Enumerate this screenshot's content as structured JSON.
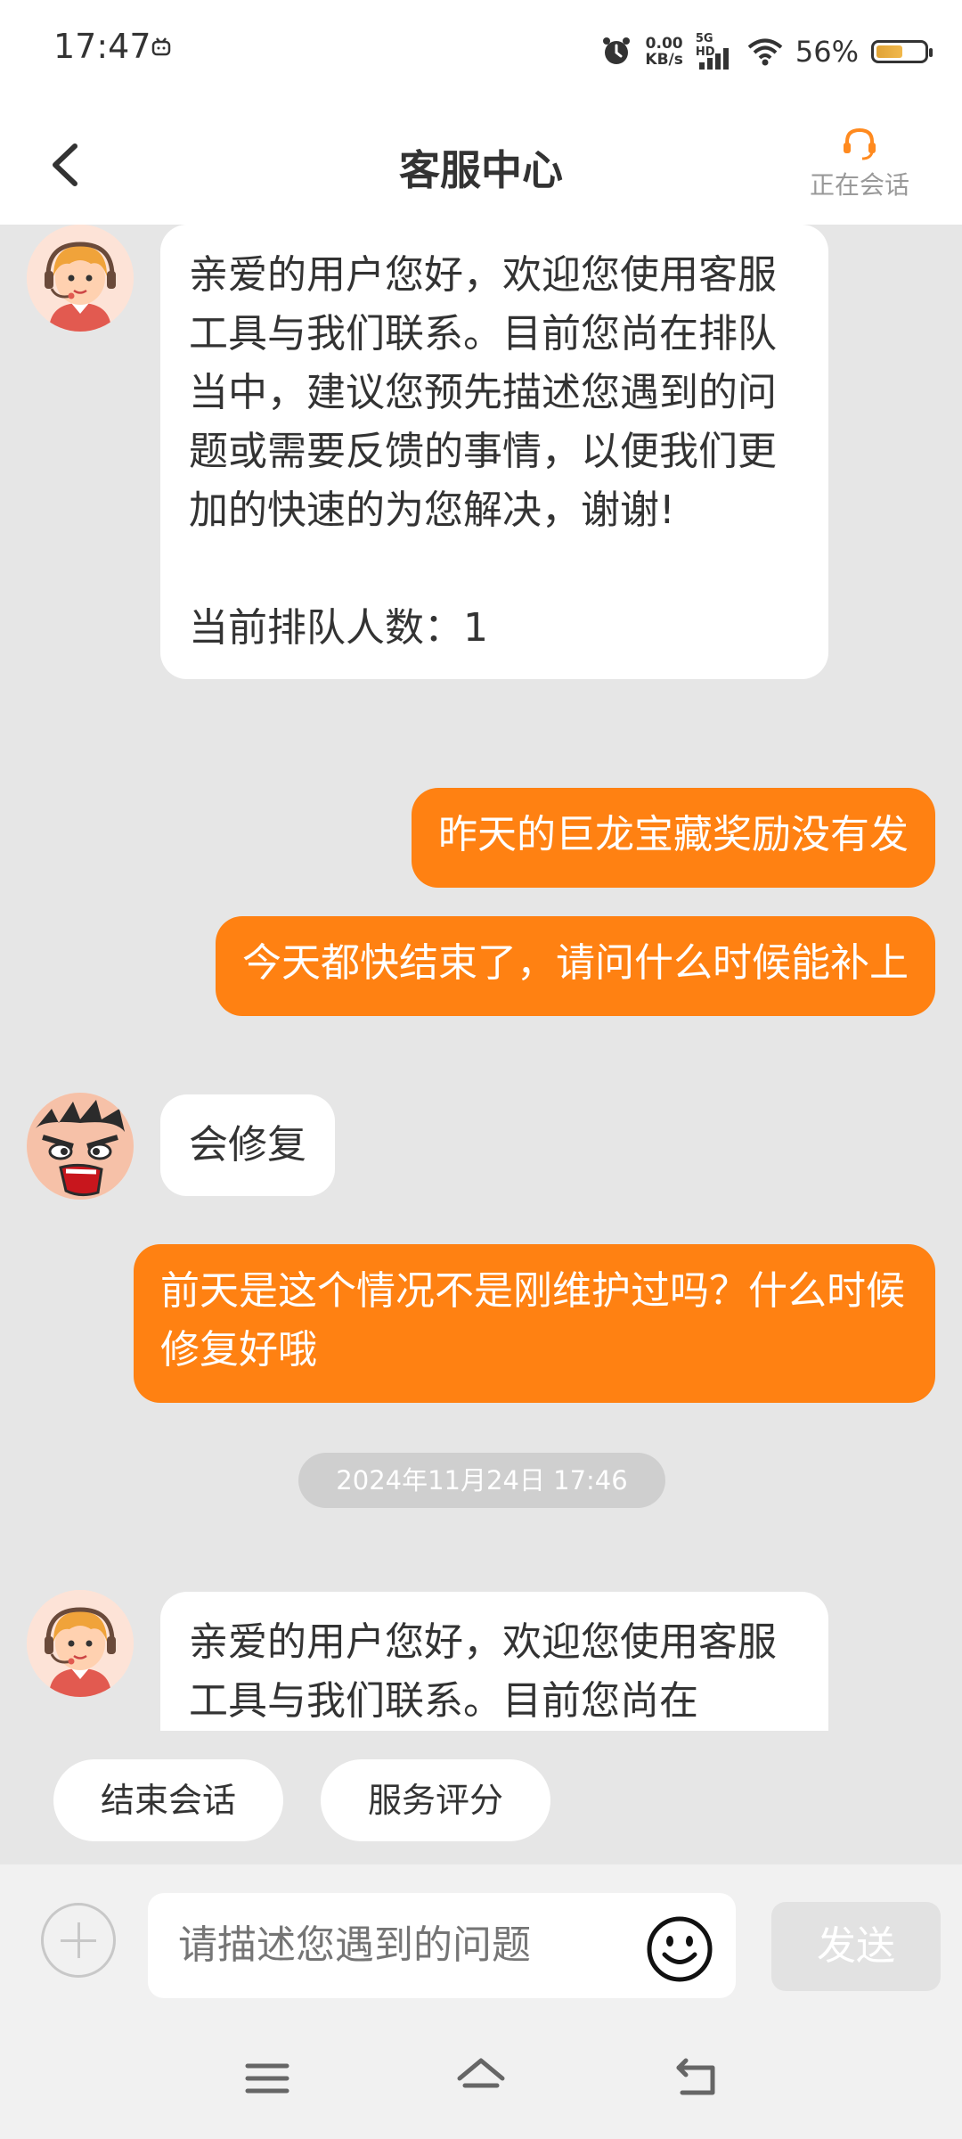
{
  "status_bar": {
    "time": "17:47",
    "net_speed_value": "0.00",
    "net_speed_unit": "KB/s",
    "signal_label": "5G HD",
    "battery_percent": "56%",
    "battery_level": 0.56
  },
  "header": {
    "title": "客服中心",
    "session_status": "正在会话"
  },
  "chat": {
    "msg1_p1": "亲爱的用户您好，欢迎您使用客服工具与我们联系。目前您尚在排队当中，建议您预先描述您遇到的问题或需要反馈的事情，以便我们更加的快速的为您解决，谢谢!",
    "msg1_p2": "当前排队人数：1",
    "msg2": "昨天的巨龙宝藏奖励没有发",
    "msg3": "今天都快结束了，请问什么时候能补上",
    "msg4": "会修复",
    "msg5": "前天是这个情况不是刚维护过吗？什么时候修复好哦",
    "timestamp": "2024年11月24日 17:46",
    "msg6_p1": "亲爱的用户您好，欢迎您使用客服工具与我们联系。目前您尚在"
  },
  "quick_actions": {
    "end_session": "结束会话",
    "rate_service": "服务评分"
  },
  "input": {
    "placeholder": "请描述您遇到的问题",
    "send_label": "发送"
  },
  "colors": {
    "accent": "#ff8112",
    "background": "#e6e6e6"
  }
}
